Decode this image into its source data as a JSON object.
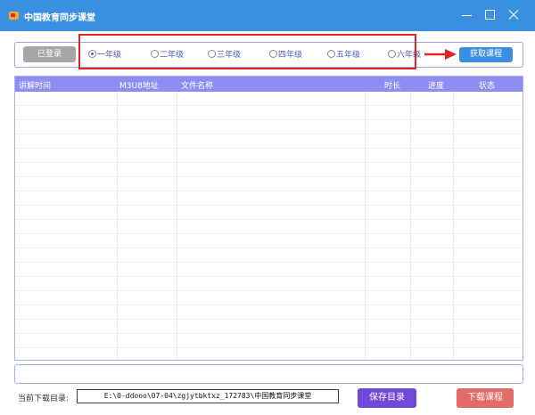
{
  "window": {
    "title": "中国教育同步课堂"
  },
  "toolbar": {
    "login_label": "已登录",
    "fetch_label": "获取课程",
    "grades": [
      {
        "label": "一年级",
        "selected": true
      },
      {
        "label": "二年级",
        "selected": false
      },
      {
        "label": "三年级",
        "selected": false
      },
      {
        "label": "四年级",
        "selected": false
      },
      {
        "label": "五年级",
        "selected": false
      },
      {
        "label": "六年级",
        "selected": false
      }
    ]
  },
  "table": {
    "columns": [
      "讲解时间",
      "M3U8地址",
      "文件名称",
      "时长",
      "进度",
      "状态"
    ],
    "rows": []
  },
  "footer": {
    "dir_label": "当前下载目录:",
    "dir_value": "E:\\0-ddooo\\07-04\\zgjytbktxz_172783\\中国教育同步课堂",
    "save_label": "保存目录",
    "download_label": "下载课程"
  },
  "colors": {
    "titlebar": "#3b8fe0",
    "table_header": "#8e8ef2",
    "save_button": "#6f4ad8",
    "download_button": "#e36b69",
    "annotation": "#e32424"
  }
}
